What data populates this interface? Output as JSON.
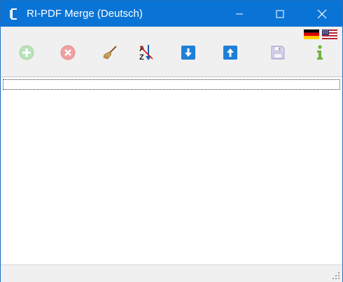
{
  "window": {
    "title": "RI-PDF Merge (Deutsch)",
    "accent_color": "#0a74d6"
  },
  "titlebar_buttons": {
    "minimize_icon": "minimize-icon",
    "maximize_icon": "maximize-icon",
    "close_icon": "close-icon"
  },
  "toolbar": {
    "items": [
      {
        "name": "add-file",
        "icon": "plus-circle-icon",
        "enabled": false
      },
      {
        "name": "remove-file",
        "icon": "x-circle-icon",
        "enabled": false
      },
      {
        "name": "clear-list",
        "icon": "broom-icon",
        "enabled": true
      },
      {
        "name": "sort-az",
        "icon": "sort-az-icon",
        "enabled": true
      },
      {
        "name": "move-down",
        "icon": "arrow-down-icon",
        "enabled": true
      },
      {
        "name": "move-up",
        "icon": "arrow-up-icon",
        "enabled": true
      },
      {
        "name": "save",
        "icon": "floppy-disk-icon",
        "enabled": false
      },
      {
        "name": "info",
        "icon": "info-icon",
        "enabled": true
      }
    ],
    "languages": [
      {
        "name": "german",
        "icon": "german-flag-icon"
      },
      {
        "name": "english",
        "icon": "us-flag-icon"
      }
    ]
  },
  "file_list": {
    "items": []
  },
  "status_bar": {
    "text": ""
  }
}
